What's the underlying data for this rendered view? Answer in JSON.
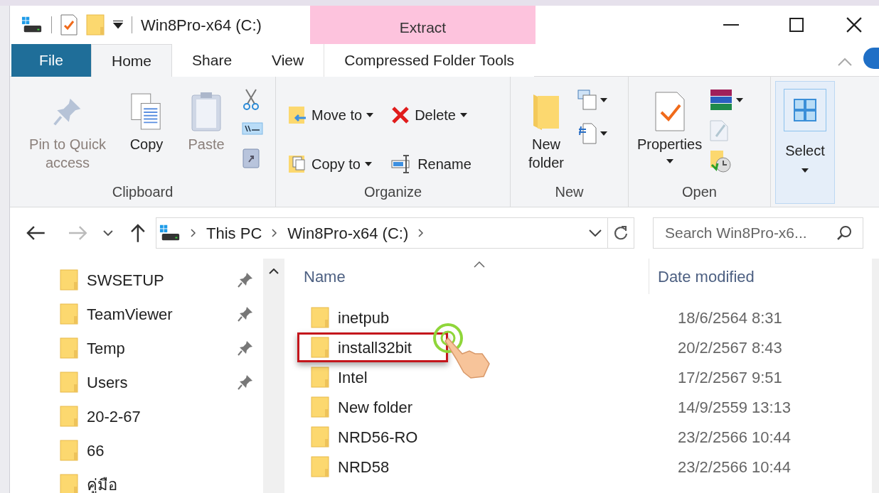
{
  "title_bar": {
    "title": "Win8Pro-x64 (C:)",
    "context_tab": "Extract"
  },
  "ribbon_tabs": [
    {
      "label": "File",
      "kind": "file",
      "selected": false
    },
    {
      "label": "Home",
      "kind": "tab",
      "selected": true
    },
    {
      "label": "Share",
      "kind": "tab",
      "selected": false
    },
    {
      "label": "View",
      "kind": "tab",
      "selected": false
    },
    {
      "label": "Compressed Folder Tools",
      "kind": "context",
      "selected": false
    }
  ],
  "ribbon_groups": [
    {
      "label": "Clipboard",
      "buttons": [
        {
          "label": "Pin to Quick access",
          "disabled": true
        },
        {
          "label": "Copy",
          "disabled": false
        },
        {
          "label": "Paste",
          "disabled": true
        }
      ]
    },
    {
      "label": "Organize",
      "buttons": [
        {
          "label": "Move to"
        },
        {
          "label": "Copy to"
        },
        {
          "label": "Delete"
        },
        {
          "label": "Rename"
        }
      ]
    },
    {
      "label": "New",
      "buttons": [
        {
          "label": "New folder"
        }
      ]
    },
    {
      "label": "Open",
      "buttons": [
        {
          "label": "Properties"
        }
      ]
    }
  ],
  "select_button": {
    "label": "Select"
  },
  "address_bar": {
    "crumbs": [
      "This PC",
      "Win8Pro-x64 (C:)"
    ]
  },
  "search": {
    "placeholder": "Search Win8Pro-x6..."
  },
  "nav_items": [
    {
      "name": "SWSETUP",
      "pinned": true
    },
    {
      "name": "TeamViewer",
      "pinned": true
    },
    {
      "name": "Temp",
      "pinned": true
    },
    {
      "name": "Users",
      "pinned": true
    },
    {
      "name": "20-2-67",
      "pinned": false
    },
    {
      "name": "66",
      "pinned": false
    },
    {
      "name": "คู่มือ",
      "pinned": false
    }
  ],
  "columns": [
    "Name",
    "Date modified"
  ],
  "files": [
    {
      "name": "inetpub",
      "date": "18/6/2564 8:31",
      "highlighted": false
    },
    {
      "name": "install32bit",
      "date": "20/2/2567 8:43",
      "highlighted": true
    },
    {
      "name": "Intel",
      "date": "17/2/2567 9:51",
      "highlighted": false
    },
    {
      "name": "New folder",
      "date": "14/9/2559 13:13",
      "highlighted": false
    },
    {
      "name": "NRD56-RO",
      "date": "23/2/2566 10:44",
      "highlighted": false
    },
    {
      "name": "NRD58",
      "date": "23/2/2566 10:44",
      "highlighted": false
    }
  ]
}
